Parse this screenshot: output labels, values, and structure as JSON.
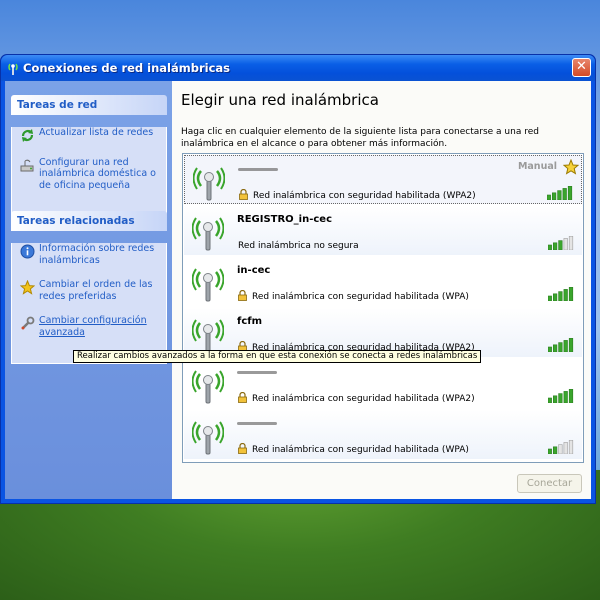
{
  "window": {
    "title": "Conexiones de red inalámbricas",
    "close_symbol": "✕"
  },
  "sidebar": {
    "network_tasks": {
      "header": "Tareas de red",
      "items": [
        {
          "label": "Actualizar lista de redes",
          "icon": "refresh-icon"
        },
        {
          "label": "Configurar una red inalámbrica doméstica o de oficina pequeña",
          "icon": "network-setup-icon"
        }
      ]
    },
    "related_tasks": {
      "header": "Tareas relacionadas",
      "items": [
        {
          "label": "Información sobre redes inalámbricas",
          "icon": "info-icon"
        },
        {
          "label": "Cambiar el orden de las redes preferidas",
          "icon": "star-icon"
        },
        {
          "label": "Cambiar configuración avanzada",
          "icon": "wrench-icon"
        }
      ]
    }
  },
  "main": {
    "heading": "Elegir una red inalámbrica",
    "intro": "Haga clic en cualquier elemento de la siguiente lista para conectarse a una red inalámbrica en el alcance o para obtener más información.",
    "networks": [
      {
        "ssid": "",
        "status": "Red inalámbrica con seguridad habilitada (WPA2)",
        "secured": true,
        "signal": 5,
        "manual_label": "Manual",
        "selected": true
      },
      {
        "ssid": "REGISTRO_in-cec",
        "status": "Red inalámbrica no segura",
        "secured": false,
        "signal": 3
      },
      {
        "ssid": "in-cec",
        "status": "Red inalámbrica con seguridad habilitada (WPA)",
        "secured": true,
        "signal": 5
      },
      {
        "ssid": "fcfm",
        "status": "Red inalámbrica con seguridad habilitada (WPA2)",
        "secured": true,
        "signal": 5
      },
      {
        "ssid": "",
        "status": "Red inalámbrica con seguridad habilitada (WPA2)",
        "secured": true,
        "signal": 5
      },
      {
        "ssid": "",
        "status": "Red inalámbrica con seguridad habilitada (WPA)",
        "secured": true,
        "signal": 2
      }
    ],
    "connect_label": "Conectar"
  },
  "tooltip": "Realizar cambios avanzados a la forma en que esta conexión se conecta a redes inalámbricas",
  "colors": {
    "task_link": "#215dc6",
    "signal_green": "#3aa52c",
    "titlebar": "#0a5fe6"
  }
}
